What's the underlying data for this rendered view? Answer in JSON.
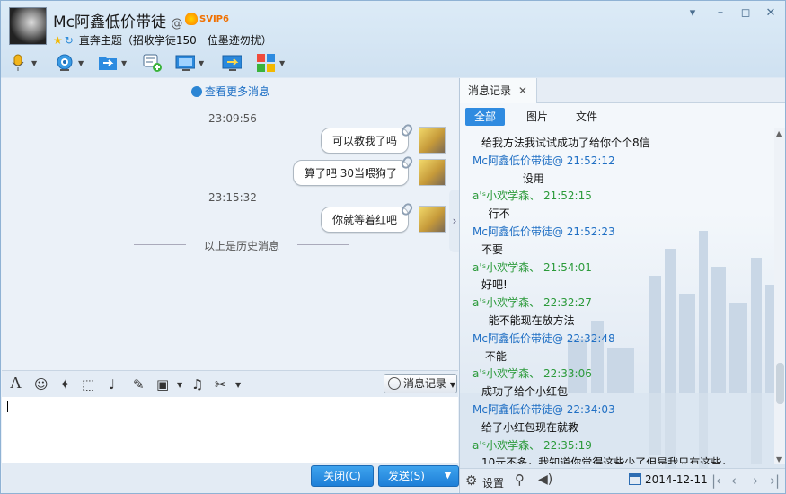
{
  "header": {
    "name": "Mc阿鑫低价带徒",
    "at": "@",
    "badge": "SVIP6",
    "status": "直奔主题（招收学徒150一位墨迹勿扰）"
  },
  "chat": {
    "view_more": "查看更多消息",
    "history_divider": "以上是历史消息",
    "items": [
      {
        "type": "time",
        "text": "23:09:56"
      },
      {
        "type": "bubble",
        "text": "可以教我了吗"
      },
      {
        "type": "bubble",
        "text": "算了吧   30当喂狗了"
      },
      {
        "type": "time",
        "text": "23:15:32"
      },
      {
        "type": "bubble",
        "text": "你就等着红吧"
      }
    ]
  },
  "format_bar": {
    "history_button": "消息记录"
  },
  "buttons": {
    "close": "关闭(C)",
    "send": "发送(S)"
  },
  "right": {
    "tab": "消息记录",
    "filters": [
      "全部",
      "图片",
      "文件"
    ],
    "active_filter": "全部",
    "messages": [
      {
        "kind": "text",
        "text": "给我方法我试试成功了给你个个8信"
      },
      {
        "kind": "me",
        "text": "Mc阿鑫低价带徒@ 21:52:12"
      },
      {
        "kind": "text",
        "text": "            设用"
      },
      {
        "kind": "oth",
        "text": "a'ˢ小欢学森、 21:52:15"
      },
      {
        "kind": "text",
        "text": "  行不"
      },
      {
        "kind": "me",
        "text": "Mc阿鑫低价带徒@ 21:52:23"
      },
      {
        "kind": "text",
        "text": "不要"
      },
      {
        "kind": "oth",
        "text": "a'ˢ小欢学森、 21:54:01"
      },
      {
        "kind": "text",
        "text": "好吧!"
      },
      {
        "kind": "oth",
        "text": "a'ˢ小欢学森、 22:32:27"
      },
      {
        "kind": "text",
        "text": "  能不能现在放方法"
      },
      {
        "kind": "me",
        "text": "Mc阿鑫低价带徒@ 22:32:48"
      },
      {
        "kind": "text",
        "text": " 不能"
      },
      {
        "kind": "oth",
        "text": "a'ˢ小欢学森、 22:33:06"
      },
      {
        "kind": "text",
        "text": "成功了给个小红包"
      },
      {
        "kind": "me",
        "text": "Mc阿鑫低价带徒@ 22:34:03"
      },
      {
        "kind": "text",
        "text": "给了小红包现在就教"
      },
      {
        "kind": "oth",
        "text": "a'ˢ小欢学森、 22:35:19"
      },
      {
        "kind": "text",
        "text": "10元不多，我知道你觉得这些少了但是我只有这些，"
      }
    ],
    "settings": "设置",
    "date": "2014-12-11"
  },
  "colors": {
    "accent": "#2f8be0",
    "me": "#1f6fc4",
    "other": "#2b9a3a"
  }
}
